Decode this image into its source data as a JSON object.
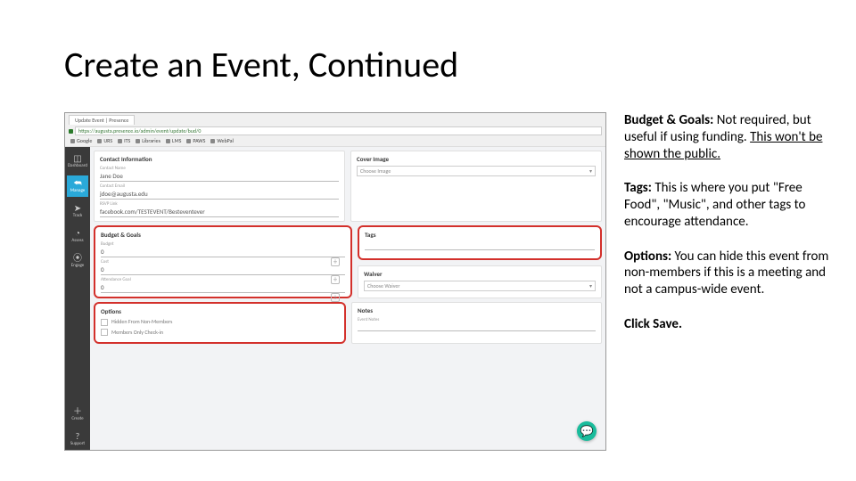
{
  "slide": {
    "title": "Create an Event, Continued"
  },
  "browser": {
    "tab_title": "Update Event | Presence",
    "url": "https://augusta.presence.io/admin/event/update/bud/0",
    "bookmarks": [
      "Google",
      "URS",
      "ITS",
      "Libraries",
      "LMS",
      "PAWS",
      "WebPal"
    ]
  },
  "sidebar": [
    {
      "icon": "◫",
      "label": "Dashboard"
    },
    {
      "icon": "⮪",
      "label": "Manage"
    },
    {
      "icon": "➤",
      "label": "Track"
    },
    {
      "icon": "◔",
      "label": "Assess"
    },
    {
      "icon": "⦿",
      "label": "Engage"
    },
    {
      "icon": "＋",
      "label": "Create"
    },
    {
      "icon": "?",
      "label": "Support"
    }
  ],
  "cards": {
    "contact": {
      "title": "Contact Information",
      "name_label": "Contact Name",
      "name_value": "Jane Doe",
      "email_label": "Contact Email",
      "email_value": "jdoe@augusta.edu",
      "rsvp_label": "RSVP Link",
      "rsvp_value": "facebook.com/TESTEVENT/Besteventever"
    },
    "cover": {
      "title": "Cover Image",
      "placeholder": "Choose Image"
    },
    "budget": {
      "title": "Budget & Goals",
      "budget_label": "Budget",
      "budget_value": "0",
      "cost_label": "Cost",
      "cost_value": "0",
      "goal_label": "Attendance Goal",
      "goal_value": "0"
    },
    "tags": {
      "title": "Tags"
    },
    "waiver": {
      "title": "Waiver",
      "placeholder": "Choose Waiver"
    },
    "options": {
      "title": "Options",
      "opt1": "Hidden From Non-Members",
      "opt2": "Members Only Check-in"
    },
    "notescard": {
      "title": "Notes",
      "label": "Event Notes"
    }
  },
  "notes": {
    "b1_h": "Budget & Goals:",
    "b1_t": " Not required, but useful if using funding. ",
    "b1_u": "This won't be shown the public.",
    "b2_h": "Tags:",
    "b2_t": " This is where you put \"Free Food\", \"Music\", and other tags to encourage attendance.",
    "b3_h": "Options:",
    "b3_t": " You can hide this event from non-members if this is a meeting and not a campus-wide event.",
    "b4": "Click Save."
  }
}
